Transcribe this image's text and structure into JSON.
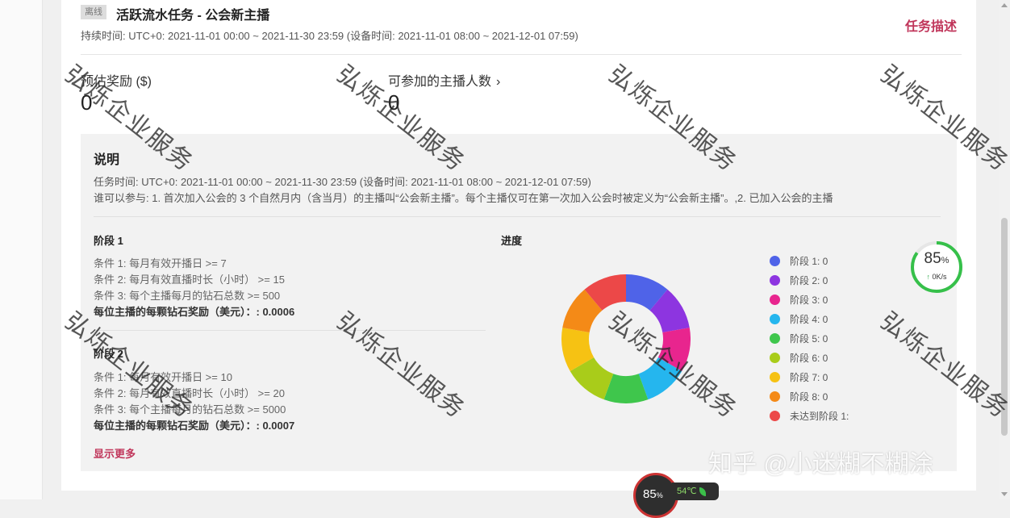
{
  "header": {
    "status_badge": "离线",
    "task_title": "活跃流水任务 - 公会新主播",
    "duration": "持续时间: UTC+0: 2021-11-01 00:00 ~ 2021-11-30 23:59 (设备时间: 2021-11-01 08:00 ~ 2021-12-01 07:59)",
    "task_description_link": "任务描述"
  },
  "stats": {
    "estimated_reward_label": "预估奖励 ($)",
    "estimated_reward_value": "0",
    "eligible_streamers_label": "可参加的主播人数",
    "eligible_streamers_value": "0"
  },
  "explanation": {
    "title": "说明",
    "task_time": "任务时间:   UTC+0: 2021-11-01 00:00 ~ 2021-11-30 23:59 (设备时间: 2021-11-01 08:00 ~ 2021-12-01 07:59)",
    "who_can_join": "谁可以参与:   1. 首次加入公会的 3 个自然月内（含当月）的主播叫“公会新主播”。每个主播仅可在第一次加入公会时被定义为“公会新主播”。,2. 已加入公会的主播"
  },
  "stages": [
    {
      "title": "阶段 1",
      "conditions": [
        "条件 1: 每月有效开播日 >= 7",
        "条件 2: 每月有效直播时长（小时） >= 15",
        "条件 3: 每个主播每月的钻石总数 >= 500"
      ],
      "reward": "每位主播的每颗钻石奖励（美元）：: 0.0006"
    },
    {
      "title": "阶段 2",
      "conditions": [
        "条件 1: 每月有效开播日 >= 10",
        "条件 2: 每月有效直播时长（小时） >= 20",
        "条件 3: 每个主播每月的钻石总数 >= 5000"
      ],
      "reward": "每位主播的每颗钻石奖励（美元）：: 0.0007"
    }
  ],
  "show_more": "显示更多",
  "progress": {
    "title": "进度",
    "legend": [
      {
        "label": "阶段 1: 0",
        "color": "#4f63e8"
      },
      {
        "label": "阶段 2: 0",
        "color": "#8d35e0"
      },
      {
        "label": "阶段 3: 0",
        "color": "#e8258e"
      },
      {
        "label": "阶段 4: 0",
        "color": "#25b6ee"
      },
      {
        "label": "阶段 5: 0",
        "color": "#3fc64c"
      },
      {
        "label": "阶段 6: 0",
        "color": "#a9cc1a"
      },
      {
        "label": "阶段 7: 0",
        "color": "#f6c213"
      },
      {
        "label": "阶段 8: 0",
        "color": "#f48a17"
      },
      {
        "label": "未达到阶段 1:",
        "color": "#ec4848"
      }
    ]
  },
  "speed_widget": {
    "percent": "85",
    "percent_unit": "%",
    "net_speed": "0K/s"
  },
  "cpu_widget": {
    "percent": "85",
    "percent_unit": "%",
    "temperature": "54℃"
  },
  "watermarks": {
    "text": "弘烁企业服务",
    "zhihu": "知乎 @小迷糊不糊涂"
  }
}
